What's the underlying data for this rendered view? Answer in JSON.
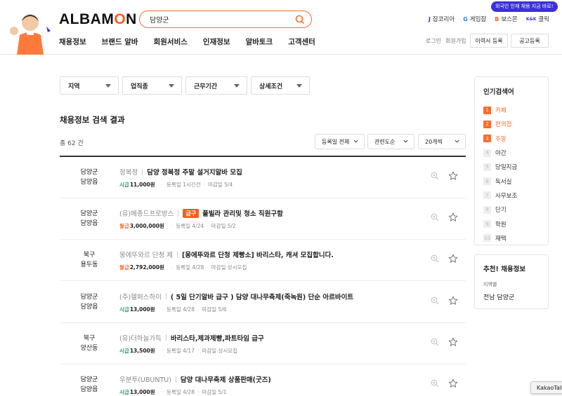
{
  "header": {
    "logo_pre": "ALBAM",
    "logo_o": "O",
    "logo_post": "N",
    "search_value": "담양군",
    "banner_badge": "외국인 인재 채용 지금 바로!",
    "partners": [
      {
        "logo": "J",
        "label": "잡코리아"
      },
      {
        "logo": "G",
        "label": "게임잡"
      },
      {
        "logo": "B",
        "label": "보스몬"
      },
      {
        "logo": "K&K",
        "label": "클릭"
      }
    ],
    "gnb": [
      "채용정보",
      "브랜드 알바",
      "회원서비스",
      "인재정보",
      "알바토크",
      "고객센터"
    ],
    "login": "로그인",
    "signup": "회원가입",
    "resume_btn": "이력서 등록",
    "post_btn": "공고등록"
  },
  "filters": [
    "지역",
    "업직종",
    "근무기간",
    "상세조건"
  ],
  "results": {
    "title": "채용정보 검색 결과",
    "total": "총 62 건",
    "sorts": [
      "등록일 전체",
      "관련도순",
      "20개씩"
    ]
  },
  "jobs": [
    {
      "loc1": "담양군",
      "loc2": "담양읍",
      "company": "정복정",
      "urgent": "",
      "title": "담양 정복정 주말 설거지알바 모집",
      "pay_type": "시급",
      "pay": "11,000원",
      "reg": "등록일 1시간전",
      "deadline": "마감일 5/4"
    },
    {
      "loc1": "담양군",
      "loc2": "담양읍",
      "company": "(유)메종드프로방스",
      "urgent": "급구",
      "title": "풀빌라 관리및 청소 직원구함",
      "pay_type": "월급",
      "pay": "3,000,000원",
      "reg": "등록일 4/24",
      "deadline": "마감일 5/2"
    },
    {
      "loc1": "북구",
      "loc2": "용두동",
      "company": "몽에뚜와르 단청 제",
      "urgent": "",
      "title": "[몽에뚜와르 단청 제빵소] 바리스타, 캐셔 모집합니다.",
      "pay_type": "월급",
      "pay": "2,792,000원",
      "reg": "등록일 4/28",
      "deadline": "마감일 상시모집"
    },
    {
      "loc1": "담양군",
      "loc2": "담양읍",
      "company": "(주)헬퍼스하이",
      "urgent": "",
      "title": "( 5일 단기알바 급구 ) 담양 대나무축제(죽녹원) 단순 아르바이트",
      "pay_type": "시급",
      "pay": "13,000원",
      "reg": "등록일 4/28",
      "deadline": "마감일 5/6"
    },
    {
      "loc1": "북구",
      "loc2": "양산동",
      "company": "(유)더하늘가득",
      "urgent": "",
      "title": "바리스타,제과제빵,파트타임 급구",
      "pay_type": "시급",
      "pay": "13,500원",
      "reg": "등록일 4/17",
      "deadline": "마감일 상시모집"
    },
    {
      "loc1": "담양군",
      "loc2": "담양읍",
      "company": "우분투(UBUNTU)",
      "urgent": "",
      "title": "담양 대나무축제 상품판매(굿즈)",
      "pay_type": "시급",
      "pay": "13,000원",
      "reg": "등록일 4/28",
      "deadline": "마감일 5/1"
    }
  ],
  "popular": {
    "title": "인기검색어",
    "items": [
      "카페",
      "편의점",
      "주말",
      "야간",
      "당일지급",
      "독서실",
      "사무보조",
      "단기",
      "학원",
      "재택"
    ]
  },
  "recommend": {
    "title": "추천! 채용정보",
    "label": "지역별",
    "value": "전남 담양군"
  },
  "kakao": "KakaoTalk"
}
